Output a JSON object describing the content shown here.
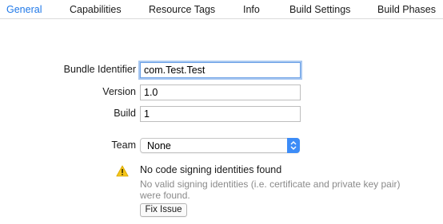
{
  "tabs": [
    {
      "label": "General",
      "selected": true
    },
    {
      "label": "Capabilities",
      "selected": false
    },
    {
      "label": "Resource Tags",
      "selected": false
    },
    {
      "label": "Info",
      "selected": false
    },
    {
      "label": "Build Settings",
      "selected": false
    },
    {
      "label": "Build Phases",
      "selected": false
    }
  ],
  "identity": {
    "bundle_identifier_label": "Bundle Identifier",
    "bundle_identifier_value": "com.Test.Test",
    "version_label": "Version",
    "version_value": "1.0",
    "build_label": "Build",
    "build_value": "1"
  },
  "signing": {
    "team_label": "Team",
    "team_value": "None",
    "warning_icon": "warning-triangle-icon",
    "warning_title": "No code signing identities found",
    "warning_description": "No valid signing identities (i.e. certificate and private key pair) were found.",
    "fix_button_label": "Fix Issue"
  },
  "colors": {
    "accent": "#1f78e8",
    "popup_arrow_bg": "#3d8cf7",
    "warning_yellow": "#f5c518",
    "secondary_text": "#8a8a8a"
  }
}
